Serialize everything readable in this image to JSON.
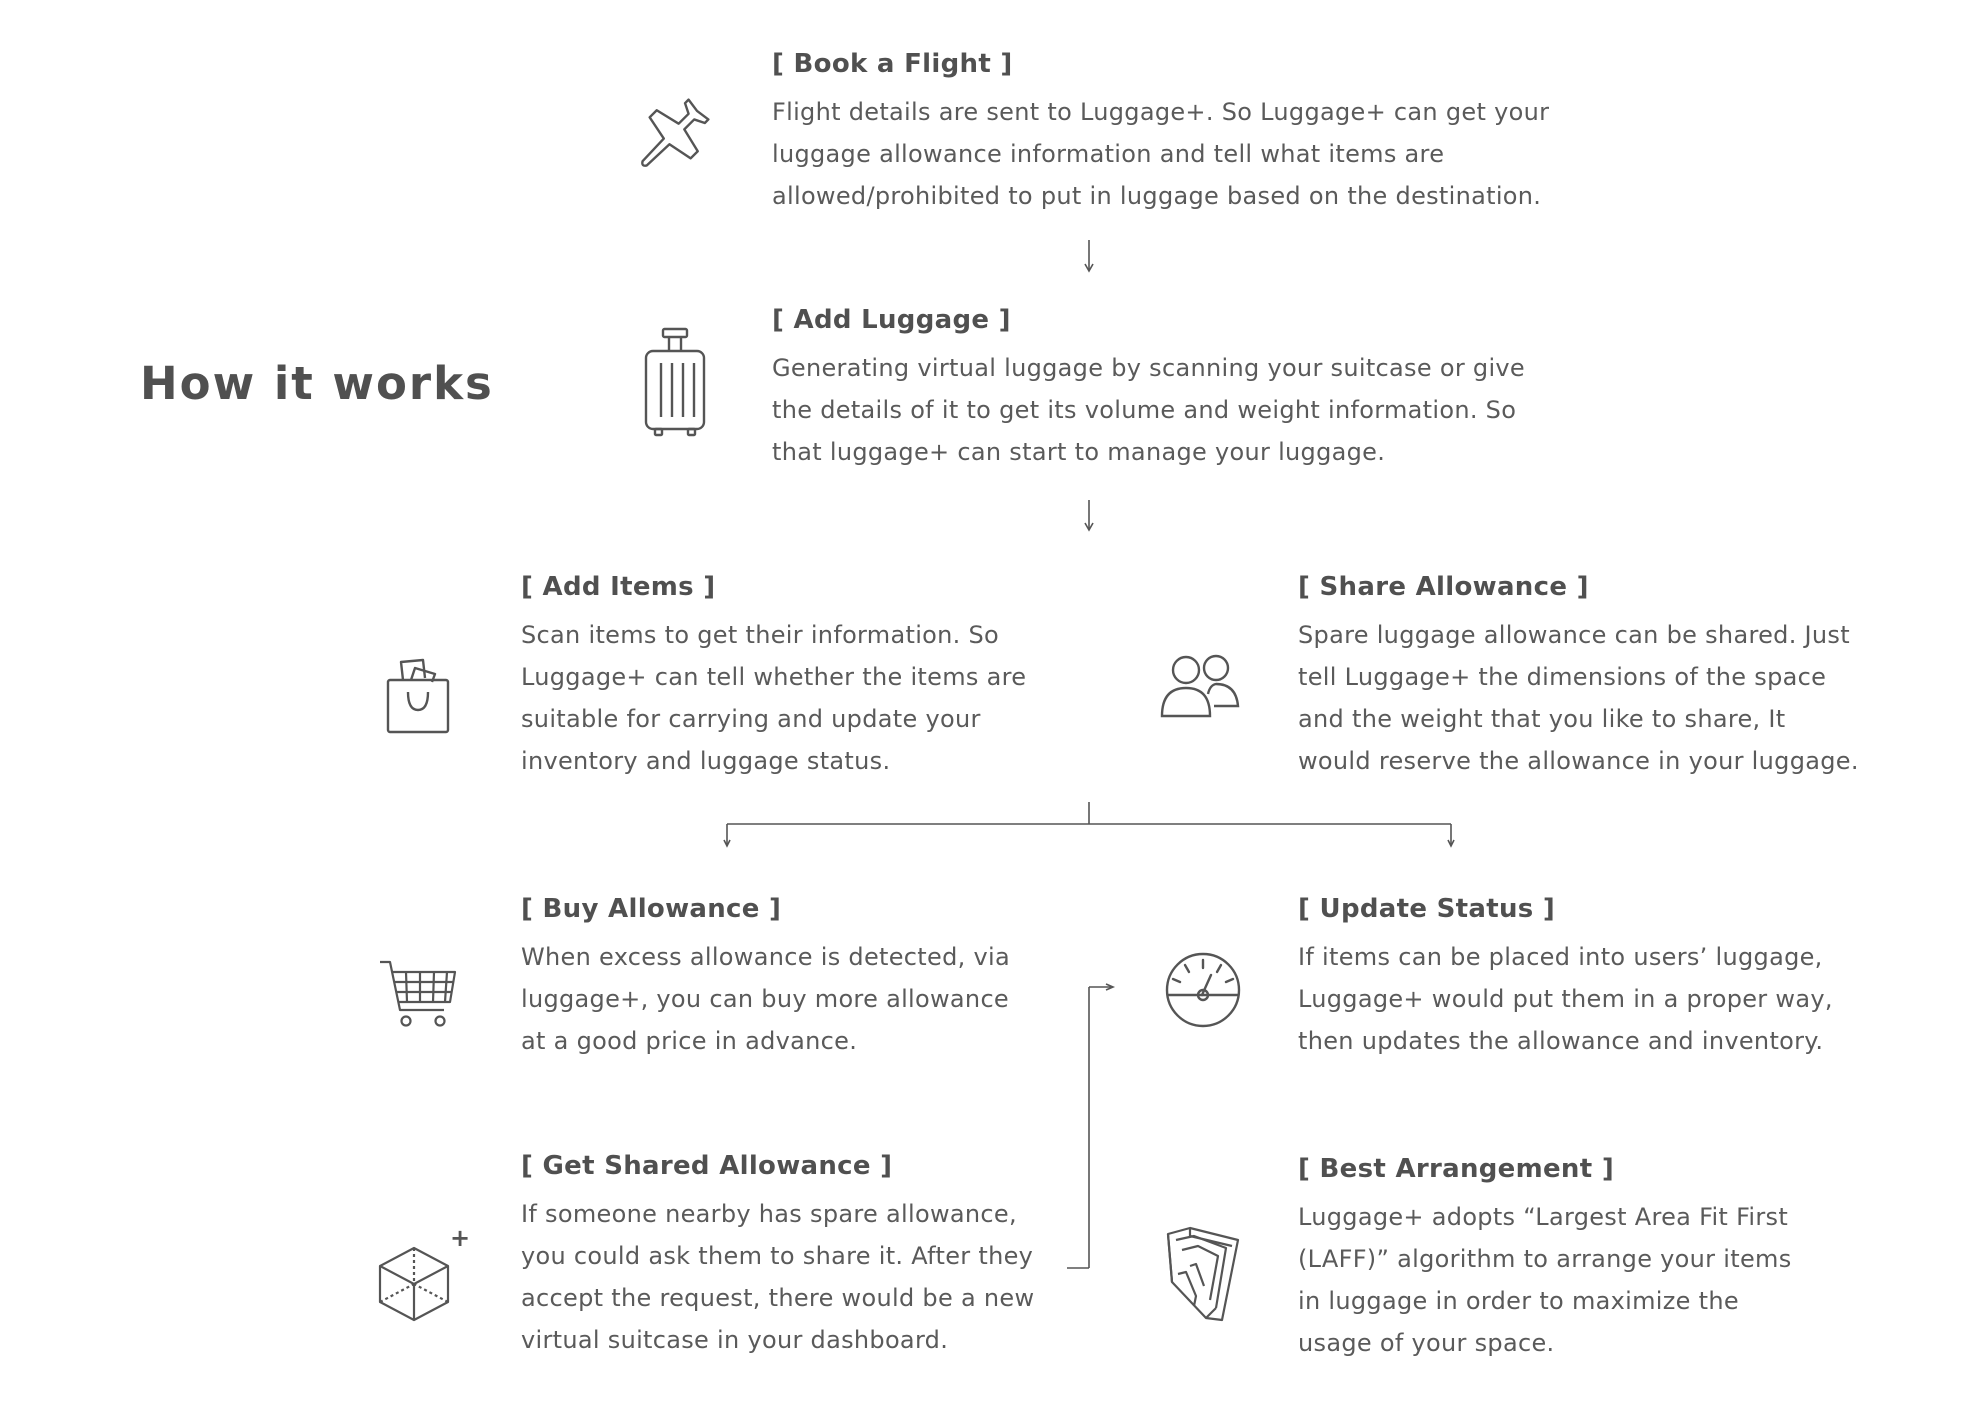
{
  "page_title": "How it works",
  "steps": {
    "book_flight": {
      "title": "[ Book a Flight ]",
      "lines": [
        "Flight details are sent to Luggage+. So Luggage+ can get your",
        "luggage allowance information and tell what items are",
        "allowed/prohibited to put in luggage based on the destination."
      ],
      "icon": "airplane-icon"
    },
    "add_luggage": {
      "title": "[ Add Luggage ]",
      "lines": [
        "Generating virtual luggage by scanning your suitcase or give",
        "the details of it to get its volume and weight information. So",
        "that luggage+ can start to manage your luggage."
      ],
      "icon": "suitcase-icon"
    },
    "add_items": {
      "title": "[ Add Items ]",
      "lines": [
        "Scan items to get their information. So",
        "Luggage+ can tell whether the items are",
        "suitable for carrying and update your",
        "inventory and luggage status."
      ],
      "icon": "shopping-bag-icon"
    },
    "share_allowance": {
      "title": "[ Share Allowance ]",
      "lines": [
        "Spare luggage allowance can be shared. Just",
        "tell Luggage+ the dimensions of the space",
        "and the weight that you like to share, It",
        "would reserve the allowance in your luggage."
      ],
      "icon": "users-icon"
    },
    "buy_allowance": {
      "title": "[ Buy Allowance ]",
      "lines": [
        "When excess allowance is detected, via",
        "luggage+, you can buy more allowance",
        "at a good price in advance."
      ],
      "icon": "shopping-cart-icon"
    },
    "update_status": {
      "title": "[ Update Status ]",
      "lines": [
        "If items can be placed into users’ luggage,",
        "Luggage+ would put them in a proper way,",
        "then updates the allowance and inventory."
      ],
      "icon": "gauge-icon"
    },
    "get_shared_allowance": {
      "title": "[ Get Shared Allowance ]",
      "lines": [
        "If someone nearby has spare allowance,",
        "you could ask them to share it. After they",
        "accept the request, there would be a new",
        "virtual suitcase in your dashboard."
      ],
      "icon": "cube-plus-icon",
      "icon_symbol": "+"
    },
    "best_arrangement": {
      "title": "[ Best Arrangement ]",
      "lines": [
        "Luggage+ adopts “Largest Area Fit First",
        "(LAFF)” algorithm to arrange your items",
        "in luggage in order to maximize the",
        "usage of your space."
      ],
      "icon": "packing-boxes-icon"
    }
  },
  "colors": {
    "text": "#5a5a5a",
    "heading": "#505050",
    "line": "#555555",
    "background": "#ffffff"
  }
}
